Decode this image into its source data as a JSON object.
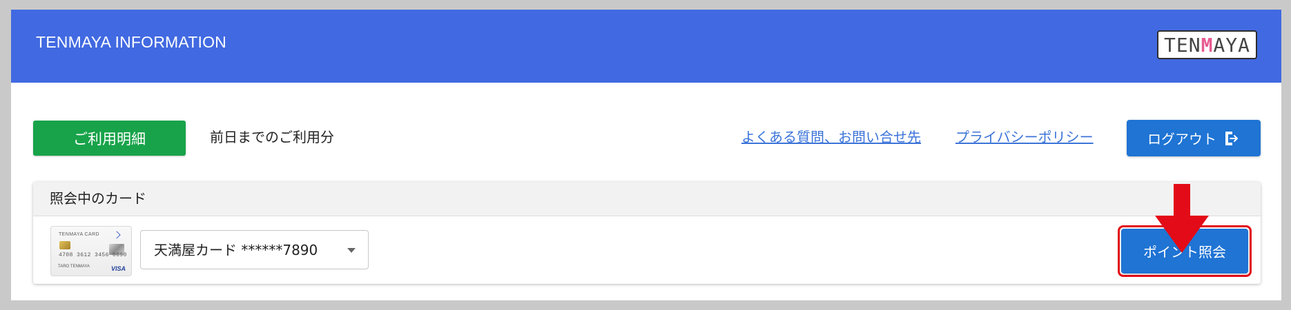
{
  "header": {
    "title": "TENMAYA INFORMATION",
    "logo_left": "TEN",
    "logo_accent": "M",
    "logo_right": "AYA"
  },
  "actions": {
    "usage_button_label": "ご利用明細",
    "usage_desc": "前日までのご利用分",
    "faq_link": "よくある質問、お問い合せ先",
    "privacy_link": "プライバシーポリシー",
    "logout_label": "ログアウト"
  },
  "card_panel": {
    "title": "照会中のカード",
    "selected_card": "天満屋カード ******7890",
    "card_brand": "TENMAYA CARD",
    "card_number": "4708 3612 3456 0890",
    "card_holder": "TARO TENMAYA",
    "card_network": "VISA",
    "point_button_label": "ポイント照会"
  },
  "colors": {
    "header": "#4169e1",
    "usage_button": "#18a34a",
    "primary_button": "#1f74d4",
    "link": "#3b73d8",
    "highlight": "#e30b17"
  },
  "icons": {
    "logout": "logout-icon",
    "dropdown": "chevron-down-icon",
    "annotation": "red-down-arrow-icon"
  }
}
